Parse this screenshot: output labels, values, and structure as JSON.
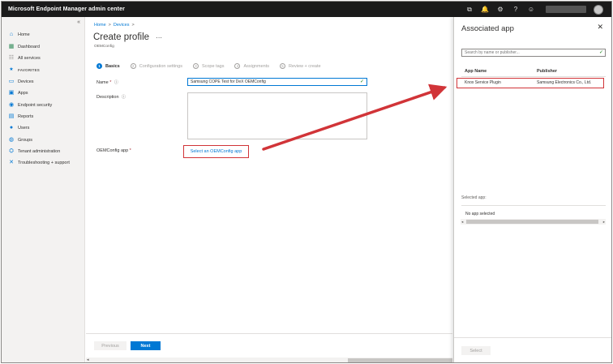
{
  "app": {
    "title": "Microsoft Endpoint Manager admin center"
  },
  "topbar": {
    "icons": [
      "remote-icon",
      "bell-icon",
      "gear-icon",
      "help-icon",
      "feedback-icon"
    ],
    "glyphs": [
      "⧉",
      "🔔",
      "⚙",
      "?",
      "☺"
    ]
  },
  "sidebar": {
    "collapse": "«",
    "items": [
      {
        "label": "Home",
        "icon": "home-icon",
        "glyph": "⌂"
      },
      {
        "label": "Dashboard",
        "icon": "dashboard-icon",
        "glyph": "▦"
      },
      {
        "label": "All services",
        "icon": "all-services-icon",
        "glyph": "☷"
      },
      {
        "label": "FAVORITES",
        "icon": "star-icon",
        "glyph": "★"
      },
      {
        "label": "Devices",
        "icon": "devices-icon",
        "glyph": "▭"
      },
      {
        "label": "Apps",
        "icon": "apps-icon",
        "glyph": "▣"
      },
      {
        "label": "Endpoint security",
        "icon": "endpoint-security-icon",
        "glyph": "◉"
      },
      {
        "label": "Reports",
        "icon": "reports-icon",
        "glyph": "▤"
      },
      {
        "label": "Users",
        "icon": "users-icon",
        "glyph": "●"
      },
      {
        "label": "Groups",
        "icon": "groups-icon",
        "glyph": "◍"
      },
      {
        "label": "Tenant administration",
        "icon": "tenant-admin-icon",
        "glyph": "⛭"
      },
      {
        "label": "Troubleshooting + support",
        "icon": "troubleshooting-icon",
        "glyph": "✕"
      }
    ]
  },
  "main": {
    "breadcrumb": [
      "Home",
      "Devices"
    ],
    "breadcrumb_sep": ">",
    "title": "Create profile",
    "more": "···",
    "subtitle": "OEMConfig",
    "steps": [
      {
        "num": "1",
        "label": "Basics"
      },
      {
        "num": "2",
        "label": "Configuration settings"
      },
      {
        "num": "3",
        "label": "Scope tags"
      },
      {
        "num": "4",
        "label": "Assignments"
      },
      {
        "num": "5",
        "label": "Review + create"
      }
    ],
    "fields": {
      "name_label": "Name",
      "required_mark": "*",
      "info_glyph": "ⓘ",
      "name_value": "Samsung COPE Test for DeX OEMConfig",
      "check_glyph": "✓",
      "description_label": "Description",
      "oemconfig_label": "OEMConfig app",
      "oemconfig_link": "Select an OEMConfig app"
    },
    "footer": {
      "previous": "Previous",
      "next": "Next"
    }
  },
  "panel": {
    "title": "Associated app",
    "close": "✕",
    "search_placeholder": "Search by name or publisher...",
    "columns": [
      "App Name",
      "Publisher"
    ],
    "rows": [
      {
        "app_name": "Knox Service Plugin",
        "publisher": "Samsung Electronics Co., Ltd."
      }
    ],
    "selected_label": "Selected app:",
    "no_app": "No app selected",
    "select_button": "Select"
  },
  "colors": {
    "accent": "#0078d4",
    "highlight": "#d13438",
    "topbar": "#1b1b1b"
  }
}
